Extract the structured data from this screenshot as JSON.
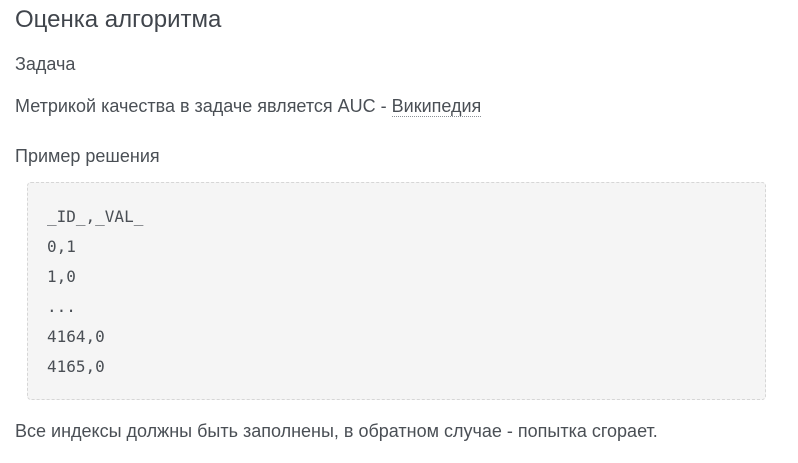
{
  "page": {
    "title": "Оценка алгоритма",
    "task_heading": "Задача",
    "metric_text": "Метрикой качества в задаче является AUC - ",
    "metric_link": "Википедия",
    "example_heading": "Пример решения",
    "code_lines": [
      "_ID_,_VAL_",
      "0,1",
      "1,0",
      "...",
      "4164,0",
      "4165,0"
    ],
    "footer_note": "Все индексы должны быть заполнены, в обратном случае - попытка сгорает."
  }
}
